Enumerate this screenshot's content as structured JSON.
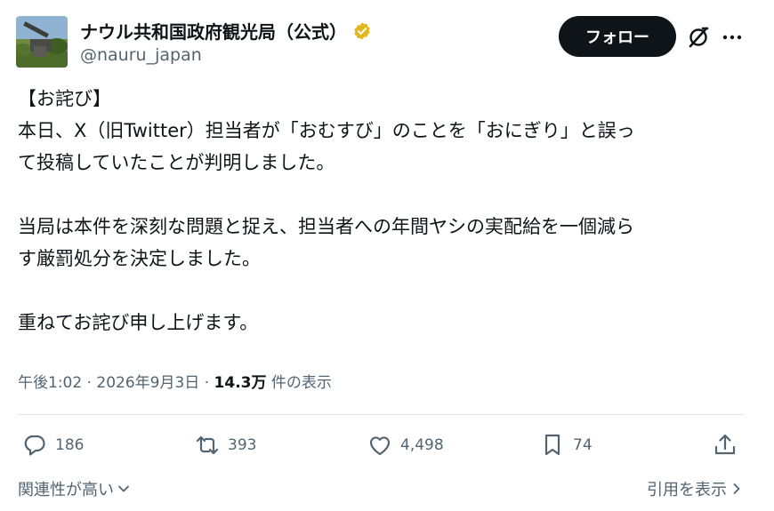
{
  "author": {
    "display_name": "ナウル共和国政府観光局（公式）",
    "handle": "@nauru_japan",
    "verified_badge": "gold-verified-badge-icon"
  },
  "follow_label": "フォロー",
  "tweet": {
    "lines": [
      "【お詫び】",
      "本日、X（旧Twitter）担当者が「おむすび」のことを「おにぎり」と誤っ",
      "て投稿していたことが判明しました。",
      "",
      "当局は本件を深刻な問題と捉え、担当者への年間ヤシの実配給を一個減ら",
      "す厳罰処分を決定しました。",
      "",
      "重ねてお詫び申し上げます。"
    ]
  },
  "meta": {
    "time": "午後1:02",
    "date": "2026年9月3日",
    "views_count": "14.3万",
    "views_label": "件の表示"
  },
  "actions": {
    "replies": "186",
    "reposts": "393",
    "likes": "4,498",
    "bookmarks": "74"
  },
  "footer": {
    "sort_label": "関連性が高い",
    "quotes_label": "引用を表示"
  },
  "colors": {
    "text": "#0f1419",
    "muted": "#536471",
    "follow_bg": "#0f1419",
    "verified_gold": "#e2b719"
  }
}
